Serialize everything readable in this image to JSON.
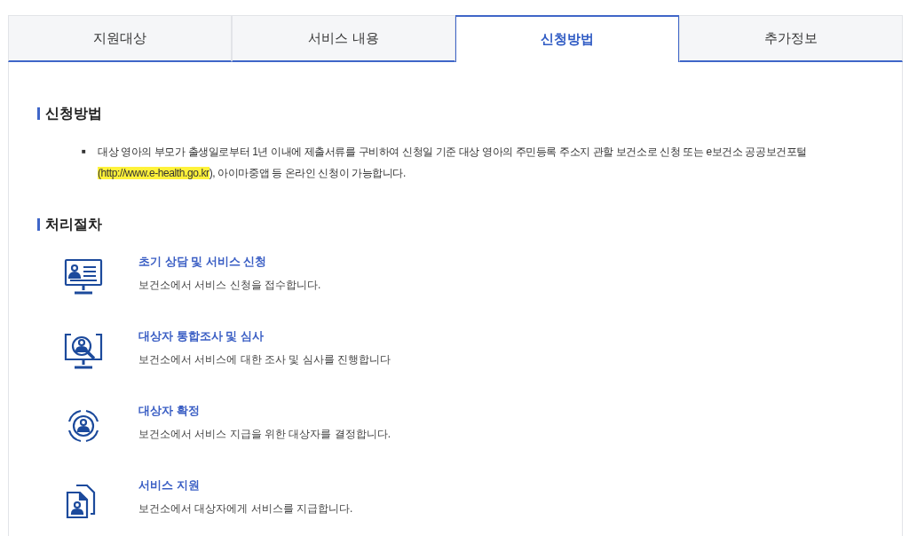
{
  "tabs": [
    {
      "label": "지원대상",
      "selected": false
    },
    {
      "label": "서비스 내용",
      "selected": false
    },
    {
      "label": "신청방법",
      "selected": true
    },
    {
      "label": "추가정보",
      "selected": false
    }
  ],
  "apply_section": {
    "heading": "신청방법",
    "bullet_marker": "■",
    "text_before": "대상 영아의 부모가 출생일로부터 1년 이내에 제출서류를 구비하여 신청일 기준 대상 영아의 주민등록 주소지 관할 보건소로 신청 또는 e보건소 공공보건포털 ",
    "link": "(http://www.e-health.go.kr",
    "text_after": "), 아이마중앱 등 온라인 신청이 가능합니다."
  },
  "process_section": {
    "heading": "처리절차",
    "steps": [
      {
        "kind": "monitor-profile",
        "title": "초기 상담 및 서비스 신청",
        "description": "보건소에서 서비스 신청을 접수합니다."
      },
      {
        "kind": "monitor-search",
        "title": "대상자 통합조사 및 심사",
        "description": "보건소에서 서비스에 대한 조사 및 심사를 진행합니다"
      },
      {
        "kind": "target",
        "title": "대상자 확정",
        "description": "보건소에서 서비스 지급을 위한 대상자를 결정합니다."
      },
      {
        "kind": "documents",
        "title": "서비스 지원",
        "description": "보건소에서 대상자에게 서비스를 지급합니다."
      }
    ]
  }
}
